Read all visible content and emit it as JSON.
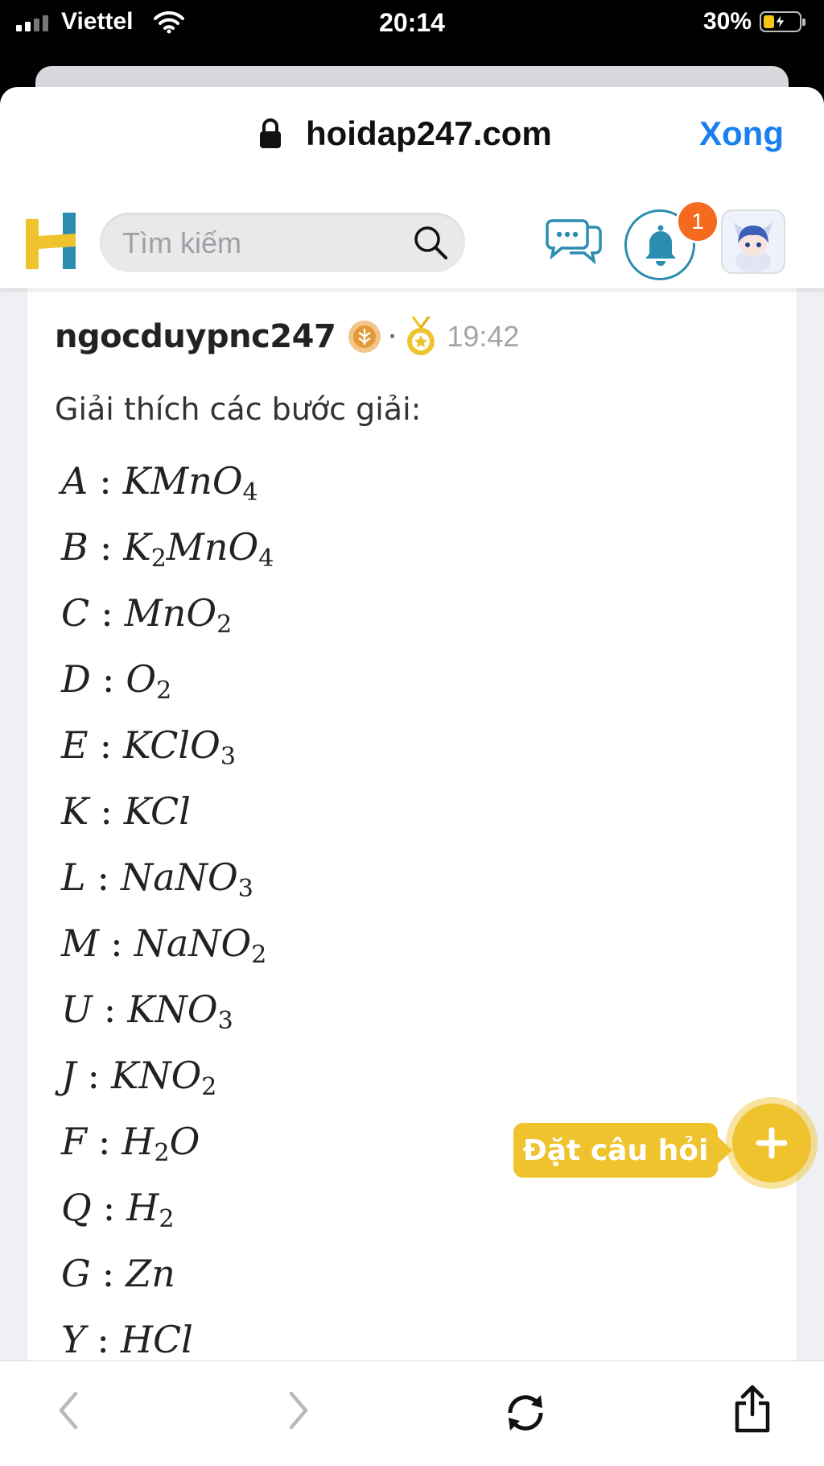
{
  "status_bar": {
    "carrier": "Viettel",
    "time": "20:14",
    "battery": "30%",
    "battery_level": 0.3
  },
  "browser": {
    "url": "hoidap247.com",
    "done_label": "Xong"
  },
  "header": {
    "search_placeholder": "Tìm kiếm",
    "notification_count": "1"
  },
  "answer": {
    "username": "ngocduypnc247",
    "separator": "·",
    "time": "19:42",
    "explanation": "Giải thích các bước giải:",
    "formulas": [
      {
        "label": "A",
        "parts": [
          [
            "KMnO",
            "4"
          ]
        ]
      },
      {
        "label": "B",
        "parts": [
          [
            "K",
            "2"
          ],
          [
            "MnO",
            "4"
          ]
        ]
      },
      {
        "label": "C",
        "parts": [
          [
            "MnO",
            "2"
          ]
        ]
      },
      {
        "label": "D",
        "parts": [
          [
            "O",
            "2"
          ]
        ]
      },
      {
        "label": "E",
        "parts": [
          [
            "KClO",
            "3"
          ]
        ]
      },
      {
        "label": "K",
        "parts": [
          [
            "KCl",
            ""
          ]
        ]
      },
      {
        "label": "L",
        "parts": [
          [
            "NaNO",
            "3"
          ]
        ]
      },
      {
        "label": "M",
        "parts": [
          [
            "NaNO",
            "2"
          ]
        ]
      },
      {
        "label": "U",
        "parts": [
          [
            "KNO",
            "3"
          ]
        ]
      },
      {
        "label": "J",
        "parts": [
          [
            "KNO",
            "2"
          ]
        ]
      },
      {
        "label": "F",
        "parts": [
          [
            "H",
            "2"
          ],
          [
            "O",
            ""
          ]
        ]
      },
      {
        "label": "Q",
        "parts": [
          [
            "H",
            "2"
          ]
        ]
      },
      {
        "label": "G",
        "parts": [
          [
            "Zn",
            ""
          ]
        ]
      },
      {
        "label": "Y",
        "parts": [
          [
            "HCl",
            ""
          ]
        ]
      }
    ]
  },
  "fab": {
    "label": "Đặt câu hỏi"
  },
  "colors": {
    "accent_yellow": "#efc32d",
    "link_blue": "#1a7ff0",
    "badge_orange": "#f46a1f",
    "logo_teal": "#2b8db0"
  },
  "icons": [
    "lock-icon",
    "search-icon",
    "chat-icon",
    "bell-icon",
    "rank-icon",
    "medal-icon",
    "plus-icon",
    "back-icon",
    "forward-icon",
    "reload-icon",
    "share-icon"
  ]
}
